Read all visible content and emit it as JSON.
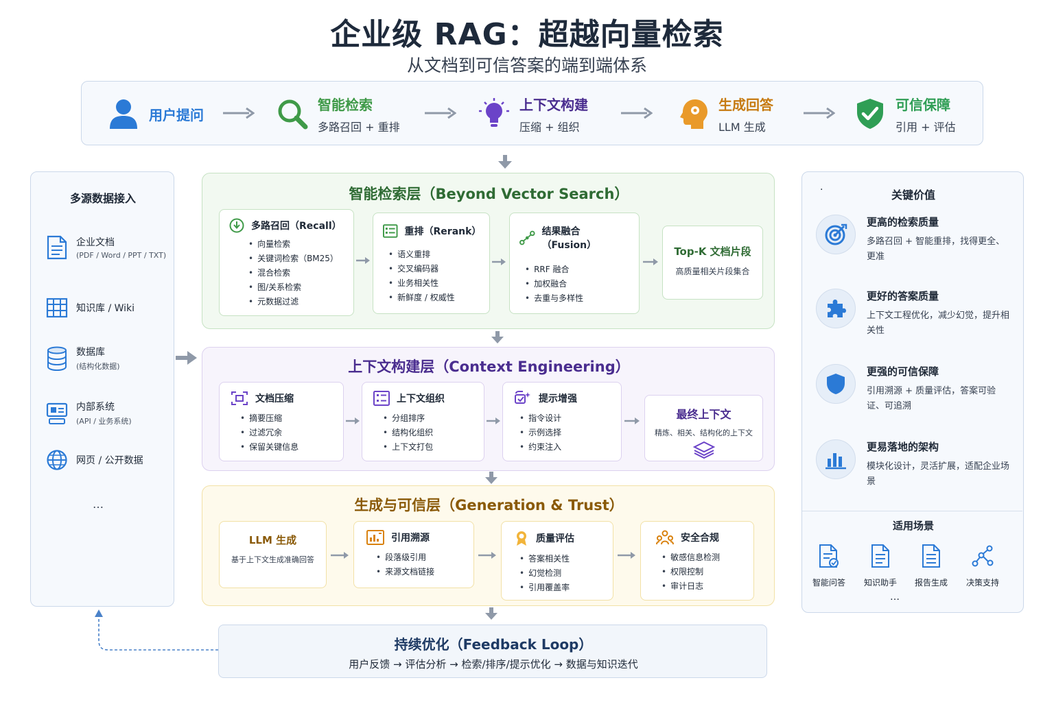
{
  "header": {
    "title": "企业级 RAG：超越向量检索",
    "subtitle": "从文档到可信答案的端到端体系"
  },
  "flow": [
    {
      "label": "用户提问",
      "sub": "",
      "icon": "user-icon",
      "color": "#2b7ad6"
    },
    {
      "label": "智能检索",
      "sub": "多路召回 + 重排",
      "icon": "search-icon",
      "color": "#3f9a48"
    },
    {
      "label": "上下文构建",
      "sub": "压缩 + 组织",
      "icon": "lightbulb-icon",
      "color": "#6b43c8"
    },
    {
      "label": "生成回答",
      "sub": "LLM 生成",
      "icon": "brain-head-icon",
      "color": "#d9820f"
    },
    {
      "label": "可信保障",
      "sub": "引用 + 评估",
      "icon": "shield-check-icon",
      "color": "#2f9e55"
    }
  ],
  "sources": {
    "title": "多源数据接入",
    "items": [
      {
        "label": "企业文档",
        "sub": "(PDF / Word / PPT / TXT)",
        "icon": "document-icon"
      },
      {
        "label": "知识库 / Wiki",
        "sub": "",
        "icon": "grid-table-icon"
      },
      {
        "label": "数据库",
        "sub": "(结构化数据)",
        "icon": "database-icon"
      },
      {
        "label": "内部系统",
        "sub": "(API / 业务系统)",
        "icon": "system-icon"
      },
      {
        "label": "网页 / 公开数据",
        "sub": "",
        "icon": "globe-icon"
      }
    ],
    "more": "…"
  },
  "retrieval_layer": {
    "title": "智能检索层（Beyond Vector Search）",
    "color": "#2f6b34",
    "cards": [
      {
        "title": "多路召回（Recall）",
        "icon": "download-circle-icon",
        "items": [
          "向量检索",
          "关键词检索（BM25）",
          "混合检索",
          "图/关系检索",
          "元数据过滤"
        ]
      },
      {
        "title": "重排（Rerank）",
        "icon": "list-icon",
        "items": [
          "语义重排",
          "交叉编码器",
          "业务相关性",
          "新鲜度 / 权威性"
        ]
      },
      {
        "title": "结果融合（Fusion）",
        "icon": "fusion-icon",
        "items": [
          "RRF 融合",
          "加权融合",
          "去重与多样性"
        ]
      }
    ],
    "result": {
      "title": "Top-K 文档片段",
      "sub": "高质量相关片段集合"
    }
  },
  "context_layer": {
    "title": "上下文构建层（Context Engineering）",
    "color": "#4a2d8f",
    "cards": [
      {
        "title": "文档压缩",
        "icon": "compress-icon",
        "items": [
          "摘要压缩",
          "过滤冗余",
          "保留关键信息"
        ]
      },
      {
        "title": "上下文组织",
        "icon": "organize-icon",
        "items": [
          "分组排序",
          "结构化组织",
          "上下文打包"
        ]
      },
      {
        "title": "提示增强",
        "icon": "prompt-icon",
        "items": [
          "指令设计",
          "示例选择",
          "约束注入"
        ]
      }
    ],
    "result": {
      "title": "最终上下文",
      "sub": "精炼、相关、结构化的上下文",
      "icon": "layers-icon"
    }
  },
  "generation_layer": {
    "title": "生成与可信层（Generation & Trust）",
    "color": "#8a5a08",
    "llm": {
      "title": "LLM 生成",
      "sub": "基于上下文生成准确回答"
    },
    "cards": [
      {
        "title": "引用溯源",
        "icon": "citation-chart-icon",
        "items": [
          "段落级引用",
          "来源文档链接"
        ]
      },
      {
        "title": "质量评估",
        "icon": "medal-icon",
        "items": [
          "答案相关性",
          "幻觉检测",
          "引用覆盖率"
        ]
      },
      {
        "title": "安全合规",
        "icon": "people-icon",
        "items": [
          "敏感信息检测",
          "权限控制",
          "审计日志"
        ]
      }
    ]
  },
  "feedback": {
    "title": "持续优化（Feedback Loop）",
    "text": "用户反馈 → 评估分析 → 检索/排序/提示优化 → 数据与知识迭代"
  },
  "values": {
    "bullet": "·",
    "title": "关键价值",
    "items": [
      {
        "title": "更高的检索质量",
        "desc": "多路召回 + 智能重排，找得更全、更准",
        "icon": "target-icon"
      },
      {
        "title": "更好的答案质量",
        "desc": "上下文工程优化，减少幻觉，提升相关性",
        "icon": "puzzle-icon"
      },
      {
        "title": "更强的可信保障",
        "desc": "引用溯源 + 质量评估，答案可验证、可追溯",
        "icon": "shield-icon"
      },
      {
        "title": "更易落地的架构",
        "desc": "模块化设计，灵活扩展，适配企业场景",
        "icon": "bar-chart-icon"
      }
    ],
    "scenarios_title": "适用场景",
    "scenarios": [
      {
        "label": "智能问答",
        "icon": "qa-doc-icon"
      },
      {
        "label": "知识助手",
        "icon": "knowledge-doc-icon"
      },
      {
        "label": "报告生成",
        "icon": "report-doc-icon"
      },
      {
        "label": "决策支持",
        "icon": "network-icon"
      }
    ],
    "scenarios_more": "…"
  },
  "colors": {
    "blue": "#2b7ad6",
    "green": "#3f9a48",
    "purple": "#6b43c8",
    "orange": "#d9820f",
    "arrow": "#8f99a8"
  }
}
